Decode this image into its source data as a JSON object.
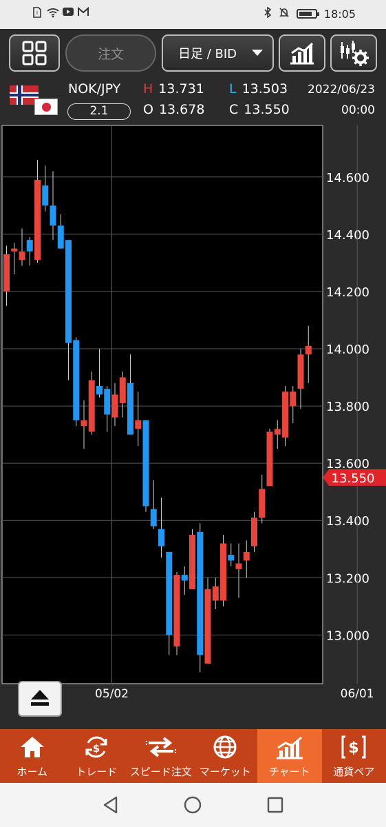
{
  "status_bar": {
    "time": "18:05",
    "left_icons": [
      "sim-icon",
      "wifi-icon",
      "youtube-icon",
      "gmail-icon"
    ],
    "right_icons": [
      "bluetooth-icon",
      "mute-icon",
      "battery-icon"
    ]
  },
  "toolbar": {
    "menu_icon": "grid-icon",
    "order_label": "注文",
    "period_label": "日足 / BID",
    "chart_type_icon": "chart-type-icon",
    "settings_icon": "chart-settings-icon"
  },
  "info": {
    "pair": "NOK/JPY",
    "spread": "2.1",
    "high_label": "H",
    "high": "13.731",
    "low_label": "L",
    "low": "13.503",
    "open_label": "O",
    "open": "13.678",
    "close_label": "C",
    "close": "13.550",
    "date": "2022/06/23",
    "time": "00:00"
  },
  "colors": {
    "up": "#e8453c",
    "down": "#2196f3",
    "price_tag": "#e0252a",
    "nav_bg": "#c4421a",
    "nav_active": "#ee6a2f"
  },
  "chart_data": {
    "type": "candlestick",
    "current_price": "13.550",
    "y_ticks": [
      "14.600",
      "14.400",
      "14.200",
      "14.000",
      "13.800",
      "13.600",
      "13.400",
      "13.200",
      "13.000"
    ],
    "y_tick_values": [
      14.6,
      14.4,
      14.2,
      14.0,
      13.8,
      13.6,
      13.4,
      13.2,
      13.0
    ],
    "x_ticks": [
      "05/02",
      "06/01"
    ],
    "x_tick_index": [
      13.6,
      45.3
    ],
    "ylim": [
      12.83,
      14.78
    ],
    "grid": true,
    "candles": [
      {
        "o": 14.2,
        "h": 14.36,
        "l": 14.15,
        "c": 14.33
      },
      {
        "o": 14.34,
        "h": 14.37,
        "l": 14.26,
        "c": 14.35
      },
      {
        "o": 14.31,
        "h": 14.42,
        "l": 14.29,
        "c": 14.34
      },
      {
        "o": 14.38,
        "h": 14.39,
        "l": 14.29,
        "c": 14.34
      },
      {
        "o": 14.31,
        "h": 14.66,
        "l": 14.3,
        "c": 14.59
      },
      {
        "o": 14.57,
        "h": 14.64,
        "l": 14.48,
        "c": 14.5
      },
      {
        "o": 14.5,
        "h": 14.62,
        "l": 14.38,
        "c": 14.43
      },
      {
        "o": 14.43,
        "h": 14.47,
        "l": 14.35,
        "c": 14.35
      },
      {
        "o": 14.38,
        "h": 14.38,
        "l": 13.89,
        "c": 14.02
      },
      {
        "o": 14.03,
        "h": 14.04,
        "l": 13.73,
        "c": 13.75
      },
      {
        "o": 13.73,
        "h": 13.82,
        "l": 13.65,
        "c": 13.75
      },
      {
        "o": 13.71,
        "h": 13.92,
        "l": 13.7,
        "c": 13.89
      },
      {
        "o": 13.87,
        "h": 14.0,
        "l": 13.83,
        "c": 13.84
      },
      {
        "o": 13.86,
        "h": 13.87,
        "l": 13.71,
        "c": 13.77
      },
      {
        "o": 13.76,
        "h": 13.88,
        "l": 13.73,
        "c": 13.84
      },
      {
        "o": 13.81,
        "h": 13.92,
        "l": 13.76,
        "c": 13.9
      },
      {
        "o": 13.88,
        "h": 13.98,
        "l": 13.7,
        "c": 13.7
      },
      {
        "o": 13.72,
        "h": 13.85,
        "l": 13.66,
        "c": 13.75
      },
      {
        "o": 13.75,
        "h": 13.75,
        "l": 13.43,
        "c": 13.45
      },
      {
        "o": 13.44,
        "h": 13.54,
        "l": 13.37,
        "c": 13.38
      },
      {
        "o": 13.37,
        "h": 13.48,
        "l": 13.27,
        "c": 13.31
      },
      {
        "o": 13.29,
        "h": 13.29,
        "l": 12.93,
        "c": 13.0
      },
      {
        "o": 12.96,
        "h": 13.22,
        "l": 12.93,
        "c": 13.21
      },
      {
        "o": 13.21,
        "h": 13.24,
        "l": 13.14,
        "c": 13.19
      },
      {
        "o": 13.16,
        "h": 13.37,
        "l": 13.16,
        "c": 13.35
      },
      {
        "o": 13.36,
        "h": 13.39,
        "l": 12.87,
        "c": 12.93
      },
      {
        "o": 12.9,
        "h": 13.2,
        "l": 12.9,
        "c": 13.16
      },
      {
        "o": 13.12,
        "h": 13.2,
        "l": 13.09,
        "c": 13.17
      },
      {
        "o": 13.12,
        "h": 13.35,
        "l": 13.1,
        "c": 13.32
      },
      {
        "o": 13.28,
        "h": 13.32,
        "l": 13.24,
        "c": 13.26
      },
      {
        "o": 13.23,
        "h": 13.32,
        "l": 13.13,
        "c": 13.25
      },
      {
        "o": 13.26,
        "h": 13.33,
        "l": 13.2,
        "c": 13.29
      },
      {
        "o": 13.31,
        "h": 13.43,
        "l": 13.29,
        "c": 13.41
      },
      {
        "o": 13.41,
        "h": 13.56,
        "l": 13.39,
        "c": 13.51
      },
      {
        "o": 13.52,
        "h": 13.72,
        "l": 13.52,
        "c": 13.71
      },
      {
        "o": 13.7,
        "h": 13.75,
        "l": 13.65,
        "c": 13.72
      },
      {
        "o": 13.69,
        "h": 13.87,
        "l": 13.66,
        "c": 13.85
      },
      {
        "o": 13.8,
        "h": 13.87,
        "l": 13.74,
        "c": 13.85
      },
      {
        "o": 13.86,
        "h": 14.0,
        "l": 13.79,
        "c": 13.98
      },
      {
        "o": 13.98,
        "h": 14.08,
        "l": 13.88,
        "c": 14.01
      }
    ]
  },
  "chart_controls": {
    "collapse_icon": "eject-icon"
  },
  "bottom_nav": [
    {
      "label": "ホーム",
      "icon": "home-icon",
      "active": false
    },
    {
      "label": "トレード",
      "icon": "trade-icon",
      "active": false
    },
    {
      "label": "スピード注文",
      "icon": "speed-order-icon",
      "active": false
    },
    {
      "label": "マーケット",
      "icon": "globe-icon",
      "active": false
    },
    {
      "label": "チャート",
      "icon": "chart-icon",
      "active": true
    },
    {
      "label": "通貨ペア",
      "icon": "currency-pair-icon",
      "active": false
    }
  ],
  "system_nav": [
    "back-icon",
    "home-circle-icon",
    "recents-icon"
  ]
}
